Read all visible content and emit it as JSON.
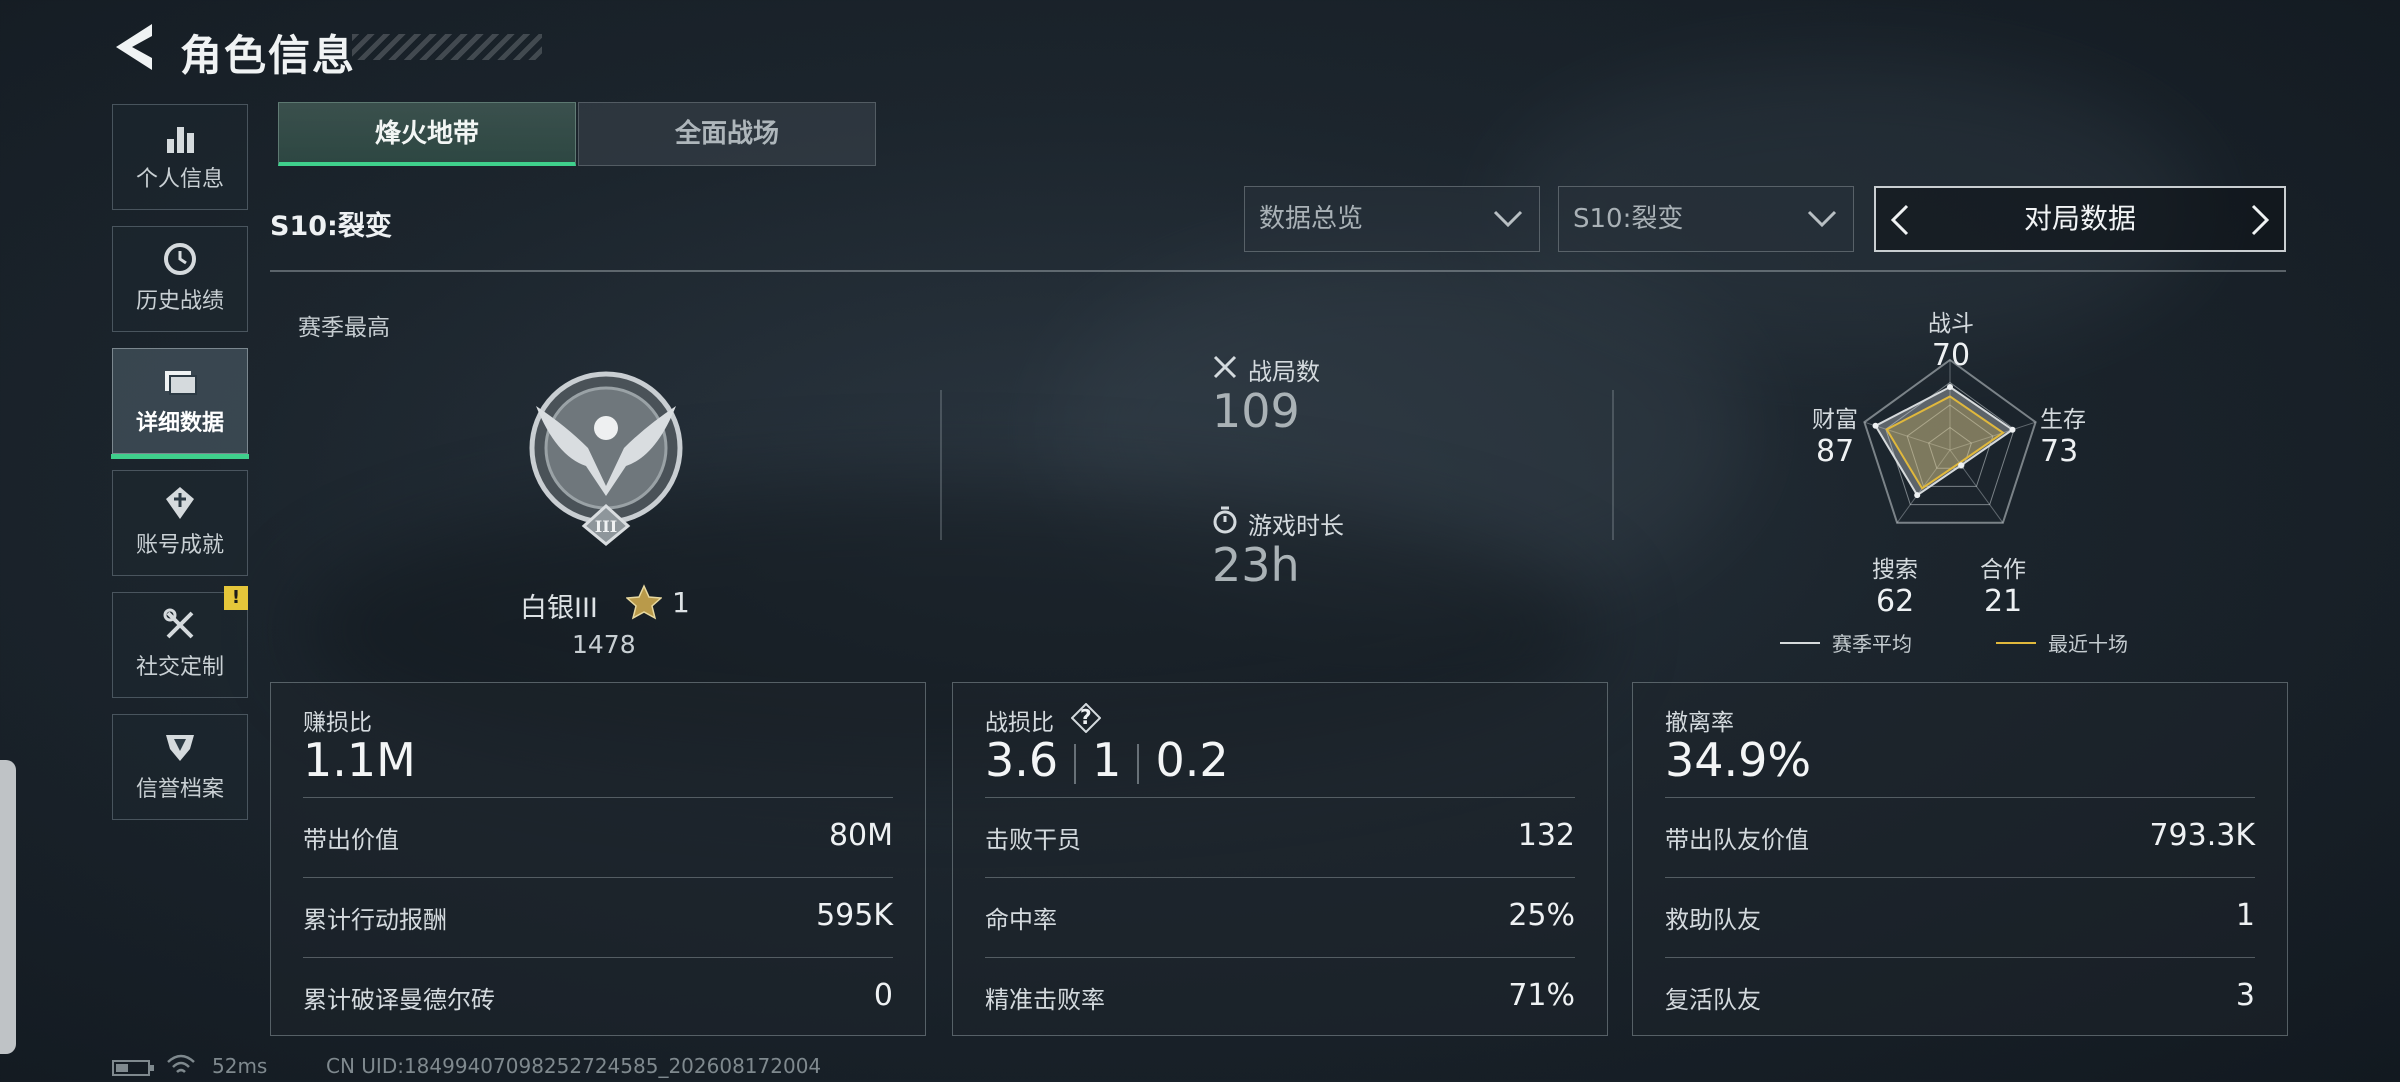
{
  "header": {
    "title": "角色信息"
  },
  "sidebar": {
    "items": [
      {
        "label": "个人信息",
        "icon": "bar-chart-icon"
      },
      {
        "label": "历史战绩",
        "icon": "history-clock-icon"
      },
      {
        "label": "详细数据",
        "icon": "folder-icon",
        "active": true
      },
      {
        "label": "账号成就",
        "icon": "achievement-icon"
      },
      {
        "label": "社交定制",
        "icon": "tools-icon",
        "badge": "!"
      },
      {
        "label": "信誉档案",
        "icon": "shield-icon"
      }
    ]
  },
  "tabs": [
    {
      "label": "烽火地带",
      "active": true
    },
    {
      "label": "全面战场"
    }
  ],
  "season_label": "S10:裂变",
  "filters": {
    "overview": "数据总览",
    "season": "S10:裂变",
    "pager": "对局数据"
  },
  "season_best": {
    "label": "赛季最高",
    "rank_name": "白银III",
    "rank_emblem_numeral": "III",
    "stars": "1",
    "score": "1478"
  },
  "summary": {
    "matches_label": "战局数",
    "matches_value": "109",
    "playtime_label": "游戏时长",
    "playtime_value": "23h"
  },
  "radar": {
    "axes": [
      {
        "name": "战斗",
        "value": "70"
      },
      {
        "name": "生存",
        "value": "73"
      },
      {
        "name": "合作",
        "value": "21"
      },
      {
        "name": "搜索",
        "value": "62"
      },
      {
        "name": "财富",
        "value": "87"
      }
    ],
    "legend_season_avg": "赛季平均",
    "legend_recent": "最近十场",
    "color_season_avg": "#d6dadc",
    "color_recent": "#e0b83c"
  },
  "cards": [
    {
      "title": "赚损比",
      "value": "1.1M",
      "rows": [
        {
          "label": "带出价值",
          "value": "80M"
        },
        {
          "label": "累计行动报酬",
          "value": "595K"
        },
        {
          "label": "累计破译曼德尔砖",
          "value": "0"
        }
      ]
    },
    {
      "title": "战损比",
      "help": "?",
      "v1": "3.6",
      "v2": "1",
      "v3": "0.2",
      "rows": [
        {
          "label": "击败干员",
          "value": "132"
        },
        {
          "label": "命中率",
          "value": "25%"
        },
        {
          "label": "精准击败率",
          "value": "71%"
        }
      ]
    },
    {
      "title": "撤离率",
      "value": "34.9%",
      "rows": [
        {
          "label": "带出队友价值",
          "value": "793.3K"
        },
        {
          "label": "救助队友",
          "value": "1"
        },
        {
          "label": "复活队友",
          "value": "3"
        }
      ]
    }
  ],
  "status": {
    "ping": "52ms",
    "uid": "CN UID:18499407098252724585_202608172004"
  },
  "colors": {
    "accent_green": "#3fd08c",
    "badge_yellow": "#e5c63a"
  }
}
